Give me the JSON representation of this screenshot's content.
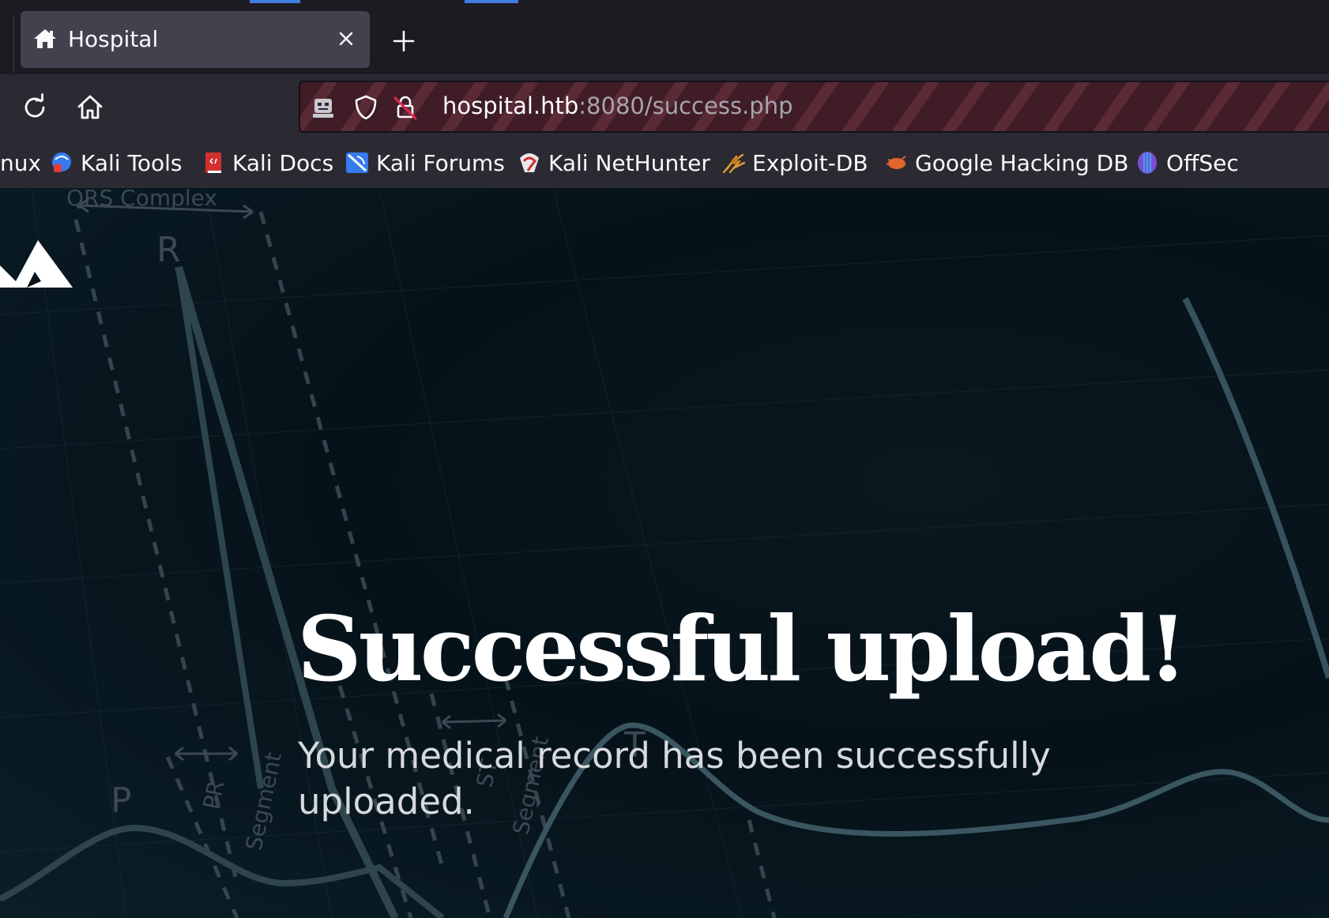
{
  "tab": {
    "title": "Hospital"
  },
  "address_bar": {
    "host": "hospital.htb",
    "rest": ":8080/success.php"
  },
  "bookmarks": [
    {
      "label": "nux",
      "icon": "bookmark-icon"
    },
    {
      "label": "Kali Tools",
      "icon": "kali-tools-icon"
    },
    {
      "label": "Kali Docs",
      "icon": "kali-docs-icon"
    },
    {
      "label": "Kali Forums",
      "icon": "kali-forums-icon"
    },
    {
      "label": "Kali NetHunter",
      "icon": "kali-nethunter-icon"
    },
    {
      "label": "Exploit-DB",
      "icon": "exploit-db-icon"
    },
    {
      "label": "Google Hacking DB",
      "icon": "ghdb-icon"
    },
    {
      "label": "OffSec",
      "icon": "offsec-icon"
    }
  ],
  "background_labels": {
    "qrs": "QRS Complex",
    "r": "R",
    "p": "P",
    "t": "T",
    "pr": "PR",
    "segment1": "Segment",
    "st": "ST",
    "segment2": "Segment"
  },
  "content": {
    "headline": "Successful upload!",
    "message": "Your medical record has been successfully uploaded."
  },
  "colors": {
    "tabbar": "#1c1b22",
    "toolbar": "#2b2a33",
    "active_tab": "#42414d",
    "url_stripe_dark": "#3f1c26",
    "url_stripe_light": "#5a2a35",
    "page_bg": "#06121a"
  }
}
